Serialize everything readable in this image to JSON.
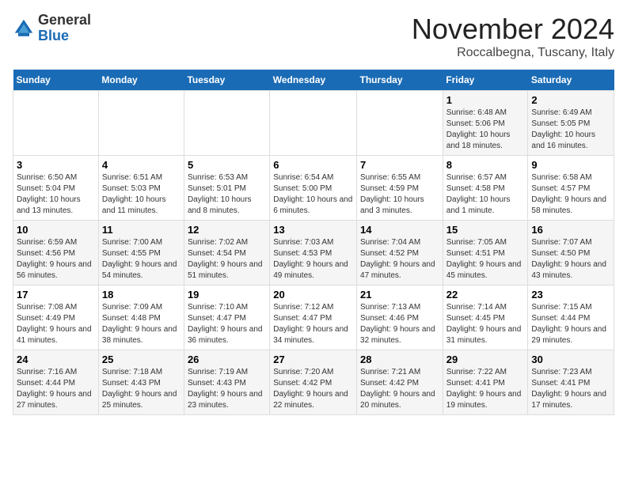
{
  "logo": {
    "general": "General",
    "blue": "Blue"
  },
  "header": {
    "title": "November 2024",
    "subtitle": "Roccalbegna, Tuscany, Italy"
  },
  "weekdays": [
    "Sunday",
    "Monday",
    "Tuesday",
    "Wednesday",
    "Thursday",
    "Friday",
    "Saturday"
  ],
  "weeks": [
    [
      {
        "day": "",
        "info": ""
      },
      {
        "day": "",
        "info": ""
      },
      {
        "day": "",
        "info": ""
      },
      {
        "day": "",
        "info": ""
      },
      {
        "day": "",
        "info": ""
      },
      {
        "day": "1",
        "info": "Sunrise: 6:48 AM\nSunset: 5:06 PM\nDaylight: 10 hours and 18 minutes."
      },
      {
        "day": "2",
        "info": "Sunrise: 6:49 AM\nSunset: 5:05 PM\nDaylight: 10 hours and 16 minutes."
      }
    ],
    [
      {
        "day": "3",
        "info": "Sunrise: 6:50 AM\nSunset: 5:04 PM\nDaylight: 10 hours and 13 minutes."
      },
      {
        "day": "4",
        "info": "Sunrise: 6:51 AM\nSunset: 5:03 PM\nDaylight: 10 hours and 11 minutes."
      },
      {
        "day": "5",
        "info": "Sunrise: 6:53 AM\nSunset: 5:01 PM\nDaylight: 10 hours and 8 minutes."
      },
      {
        "day": "6",
        "info": "Sunrise: 6:54 AM\nSunset: 5:00 PM\nDaylight: 10 hours and 6 minutes."
      },
      {
        "day": "7",
        "info": "Sunrise: 6:55 AM\nSunset: 4:59 PM\nDaylight: 10 hours and 3 minutes."
      },
      {
        "day": "8",
        "info": "Sunrise: 6:57 AM\nSunset: 4:58 PM\nDaylight: 10 hours and 1 minute."
      },
      {
        "day": "9",
        "info": "Sunrise: 6:58 AM\nSunset: 4:57 PM\nDaylight: 9 hours and 58 minutes."
      }
    ],
    [
      {
        "day": "10",
        "info": "Sunrise: 6:59 AM\nSunset: 4:56 PM\nDaylight: 9 hours and 56 minutes."
      },
      {
        "day": "11",
        "info": "Sunrise: 7:00 AM\nSunset: 4:55 PM\nDaylight: 9 hours and 54 minutes."
      },
      {
        "day": "12",
        "info": "Sunrise: 7:02 AM\nSunset: 4:54 PM\nDaylight: 9 hours and 51 minutes."
      },
      {
        "day": "13",
        "info": "Sunrise: 7:03 AM\nSunset: 4:53 PM\nDaylight: 9 hours and 49 minutes."
      },
      {
        "day": "14",
        "info": "Sunrise: 7:04 AM\nSunset: 4:52 PM\nDaylight: 9 hours and 47 minutes."
      },
      {
        "day": "15",
        "info": "Sunrise: 7:05 AM\nSunset: 4:51 PM\nDaylight: 9 hours and 45 minutes."
      },
      {
        "day": "16",
        "info": "Sunrise: 7:07 AM\nSunset: 4:50 PM\nDaylight: 9 hours and 43 minutes."
      }
    ],
    [
      {
        "day": "17",
        "info": "Sunrise: 7:08 AM\nSunset: 4:49 PM\nDaylight: 9 hours and 41 minutes."
      },
      {
        "day": "18",
        "info": "Sunrise: 7:09 AM\nSunset: 4:48 PM\nDaylight: 9 hours and 38 minutes."
      },
      {
        "day": "19",
        "info": "Sunrise: 7:10 AM\nSunset: 4:47 PM\nDaylight: 9 hours and 36 minutes."
      },
      {
        "day": "20",
        "info": "Sunrise: 7:12 AM\nSunset: 4:47 PM\nDaylight: 9 hours and 34 minutes."
      },
      {
        "day": "21",
        "info": "Sunrise: 7:13 AM\nSunset: 4:46 PM\nDaylight: 9 hours and 32 minutes."
      },
      {
        "day": "22",
        "info": "Sunrise: 7:14 AM\nSunset: 4:45 PM\nDaylight: 9 hours and 31 minutes."
      },
      {
        "day": "23",
        "info": "Sunrise: 7:15 AM\nSunset: 4:44 PM\nDaylight: 9 hours and 29 minutes."
      }
    ],
    [
      {
        "day": "24",
        "info": "Sunrise: 7:16 AM\nSunset: 4:44 PM\nDaylight: 9 hours and 27 minutes."
      },
      {
        "day": "25",
        "info": "Sunrise: 7:18 AM\nSunset: 4:43 PM\nDaylight: 9 hours and 25 minutes."
      },
      {
        "day": "26",
        "info": "Sunrise: 7:19 AM\nSunset: 4:43 PM\nDaylight: 9 hours and 23 minutes."
      },
      {
        "day": "27",
        "info": "Sunrise: 7:20 AM\nSunset: 4:42 PM\nDaylight: 9 hours and 22 minutes."
      },
      {
        "day": "28",
        "info": "Sunrise: 7:21 AM\nSunset: 4:42 PM\nDaylight: 9 hours and 20 minutes."
      },
      {
        "day": "29",
        "info": "Sunrise: 7:22 AM\nSunset: 4:41 PM\nDaylight: 9 hours and 19 minutes."
      },
      {
        "day": "30",
        "info": "Sunrise: 7:23 AM\nSunset: 4:41 PM\nDaylight: 9 hours and 17 minutes."
      }
    ]
  ]
}
